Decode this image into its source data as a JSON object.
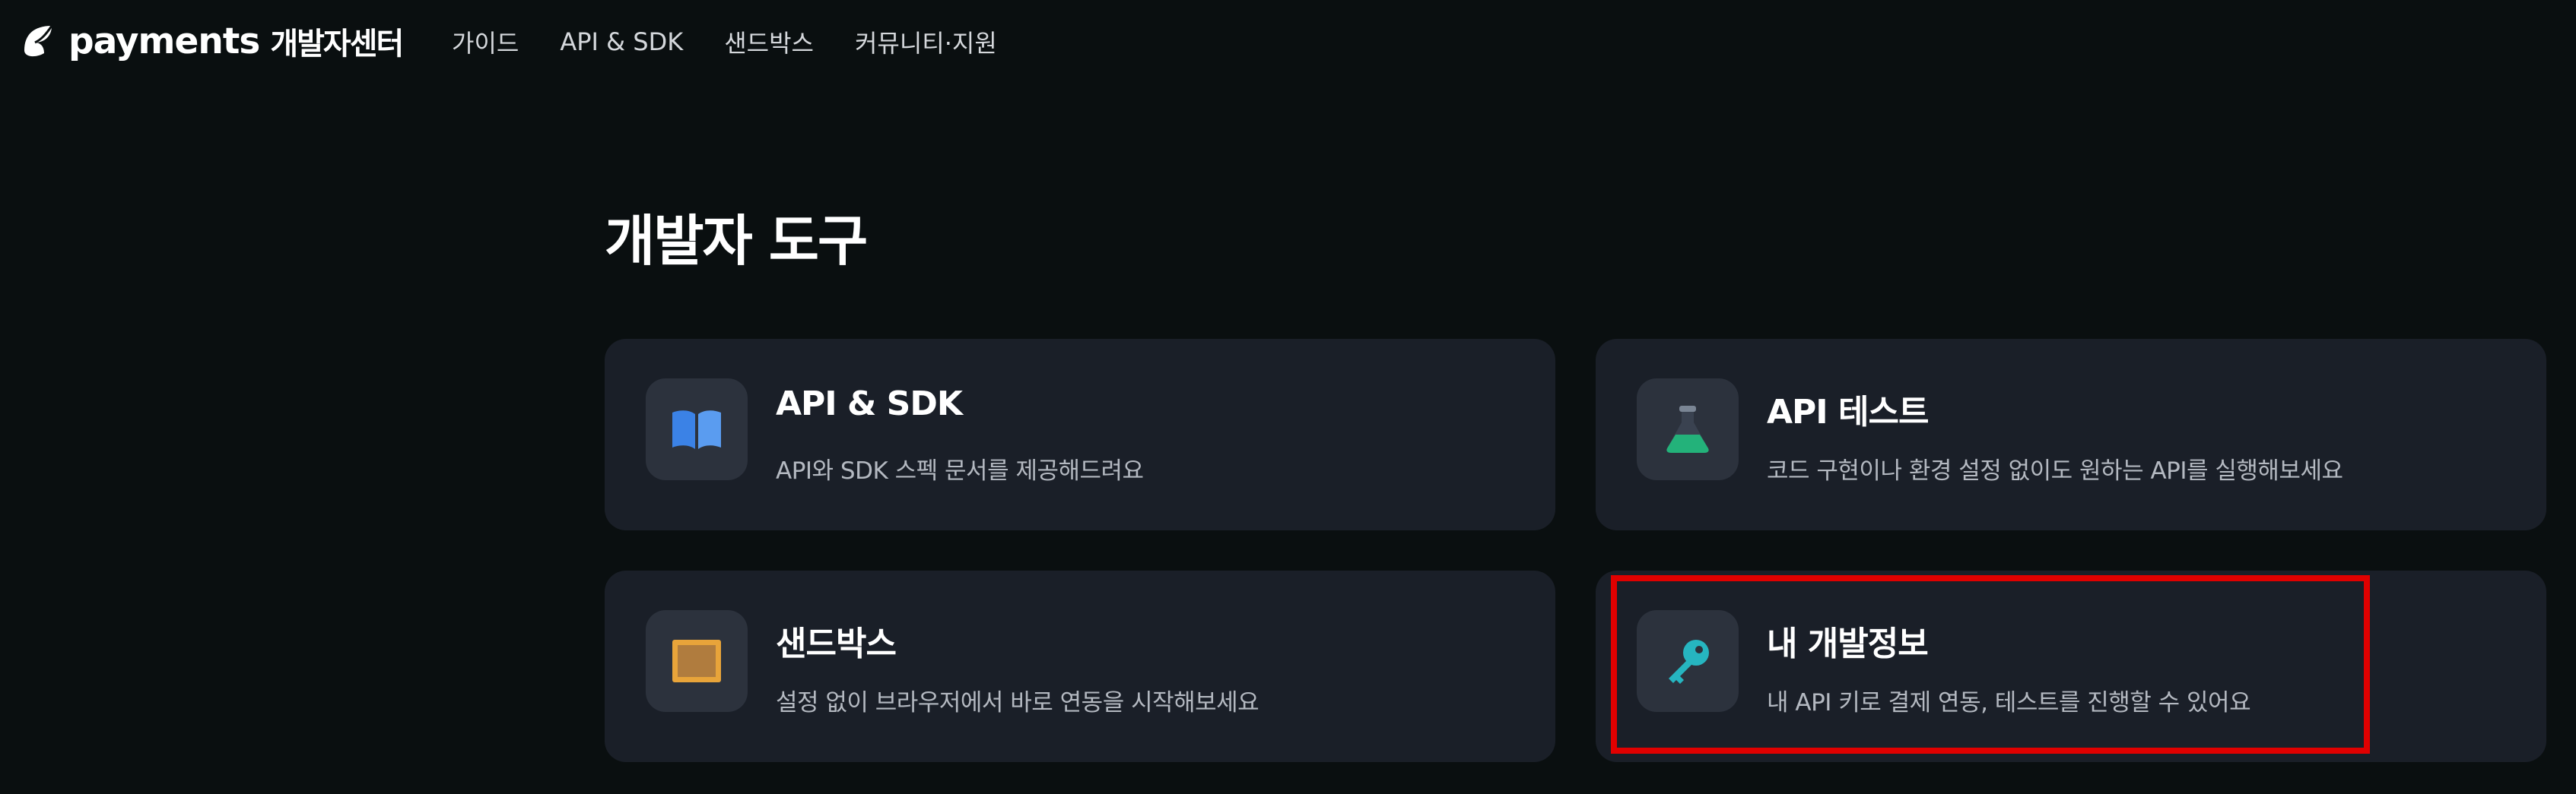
{
  "header": {
    "logo_word": "payments",
    "logo_sub": "개발자센터",
    "nav": [
      {
        "label": "가이드"
      },
      {
        "label": "API & SDK"
      },
      {
        "label": "샌드박스"
      },
      {
        "label": "커뮤니티·지원"
      }
    ]
  },
  "main": {
    "title": "개발자 도구",
    "cards": [
      {
        "title": "API & SDK",
        "description": "API와 SDK 스펙 문서를 제공해드려요",
        "icon": "book-icon"
      },
      {
        "title": "API 테스트",
        "description": "코드 구현이나 환경 설정 없이도 원하는 API를 실행해보세요",
        "icon": "flask-icon"
      },
      {
        "title": "샌드박스",
        "description": "설정 없이 브라우저에서 바로 연동을 시작해보세요",
        "icon": "sandbox-icon"
      },
      {
        "title": "내 개발정보",
        "description": "내 API 키로 결제 연동, 테스트를 진행할 수 있어요",
        "icon": "key-icon"
      }
    ]
  },
  "colors": {
    "background": "#0a0f10",
    "card": "#1a1f28",
    "icon_tile": "#2c323d",
    "highlight": "#e00000",
    "book": "#3b82e6",
    "flask": "#23b27a",
    "sandbox": "#e8a43a",
    "key": "#26b5c0"
  }
}
